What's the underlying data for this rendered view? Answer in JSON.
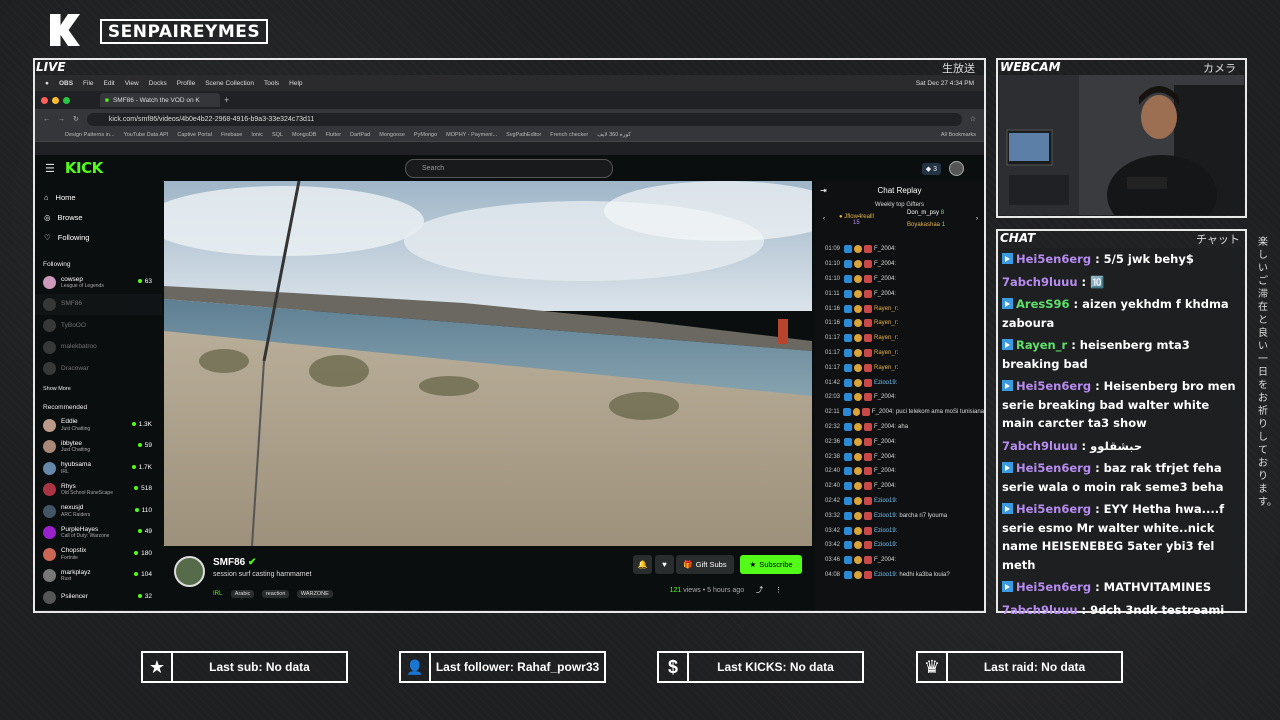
{
  "overlay": {
    "channel_name": "SENPAIREYMES",
    "live_label": "LIVE",
    "live_jp": "生放送",
    "webcam_label": "WEBCAM",
    "webcam_jp": "カメラ",
    "chat_label": "CHAT",
    "chat_jp": "チャット",
    "side_jp": "楽しいご滞在と良い一日をお祈りしております。"
  },
  "menubar": {
    "items": [
      "OBS",
      "File",
      "Edit",
      "View",
      "Docks",
      "Profile",
      "Scene Collection",
      "Tools",
      "Help"
    ],
    "datetime": "Sat Dec 27  4:34 PM"
  },
  "browser": {
    "tab_title": "SMF86 - Watch the VOD on K",
    "url": "kick.com/smf86/videos/4b0e4b22-2968-4916-b9a3-33e324c73d11",
    "bookmarks": [
      "Design Patterns in...",
      "YouTube Data API",
      "Captive Portal",
      "Firebase",
      "Ionic",
      "SQL",
      "MongoDB",
      "Flutter",
      "DartPad",
      "Mongoose",
      "PyMongo",
      "MOPHY - Paymeni...",
      "SvgPathEditor",
      "French checker",
      "كورة 360 لايف",
      "All Bookmarks"
    ]
  },
  "kick": {
    "logo": "KICK",
    "search_placeholder": "Search",
    "badge_count": "3",
    "nav": [
      {
        "label": "Home",
        "icon": "home-icon"
      },
      {
        "label": "Browse",
        "icon": "compass-icon"
      },
      {
        "label": "Following",
        "icon": "heart-icon"
      }
    ],
    "following_heading": "Following",
    "following": [
      {
        "name": "cowsep",
        "sub": "League of Legends",
        "viewers": "63",
        "live": true
      },
      {
        "name": "SMF86",
        "sub": "",
        "viewers": "",
        "live": false
      },
      {
        "name": "TyBoOO",
        "sub": "",
        "viewers": "",
        "live": false
      },
      {
        "name": "malekbatroo",
        "sub": "",
        "viewers": "",
        "live": false
      },
      {
        "name": "Dracowar",
        "sub": "",
        "viewers": "",
        "live": false
      }
    ],
    "show_more": "Show More",
    "recommended_heading": "Recommended",
    "recommended": [
      {
        "name": "Eddie",
        "sub": "Just Chatting",
        "viewers": "1.3K"
      },
      {
        "name": "ibbytee",
        "sub": "Just Chatting",
        "viewers": "59"
      },
      {
        "name": "hyubsama",
        "sub": "IRL",
        "viewers": "1.7K"
      },
      {
        "name": "Rhys",
        "sub": "Old School RuneScape",
        "viewers": "518"
      },
      {
        "name": "nexusjd",
        "sub": "ARC Raiders",
        "viewers": "110"
      },
      {
        "name": "PurpleHayes",
        "sub": "Call of Duty: Warzone",
        "viewers": "49"
      },
      {
        "name": "Chopstix",
        "sub": "Fortnite",
        "viewers": "180"
      },
      {
        "name": "markplayz",
        "sub": "Rust",
        "viewers": "104"
      },
      {
        "name": "Psilencer",
        "sub": "",
        "viewers": "32"
      }
    ],
    "streamer": {
      "name": "SMF86",
      "title": "session surf casting hammamet",
      "tags": [
        "IRL",
        "Arabic",
        "reaction",
        "WARZONE"
      ],
      "views": "121",
      "views_label": "views",
      "age": "5 hours ago",
      "gift_label": "Gift Subs",
      "subscribe_label": "Subscribe"
    },
    "replay": {
      "title": "Chat Replay",
      "gifters_heading": "Weekly top Gifters",
      "gifters": [
        {
          "name": "Jflow4reall!",
          "count": "15"
        },
        {
          "name": "Don_m_psy",
          "count": "8"
        },
        {
          "name": "Boyakashaa",
          "count": "1"
        }
      ],
      "rows": [
        {
          "time": "01:09",
          "user": "F_2004:",
          "text": ""
        },
        {
          "time": "01:10",
          "user": "F_2004:",
          "text": ""
        },
        {
          "time": "01:10",
          "user": "F_2004:",
          "text": ""
        },
        {
          "time": "01:11",
          "user": "F_2004:",
          "text": ""
        },
        {
          "time": "01:16",
          "user": "Rayen_r:",
          "text": ""
        },
        {
          "time": "01:16",
          "user": "Rayen_r:",
          "text": ""
        },
        {
          "time": "01:17",
          "user": "Rayen_r:",
          "text": ""
        },
        {
          "time": "01:17",
          "user": "Rayen_r:",
          "text": ""
        },
        {
          "time": "01:17",
          "user": "Rayen_r:",
          "text": ""
        },
        {
          "time": "01:42",
          "user": "Ezioo19:",
          "text": ""
        },
        {
          "time": "02:03",
          "user": "F_2004:",
          "text": ""
        },
        {
          "time": "02:11",
          "user": "F_2004:",
          "text": "puci telekom ama moSi tunisiana"
        },
        {
          "time": "02:32",
          "user": "F_2004:",
          "text": "aha"
        },
        {
          "time": "02:36",
          "user": "F_2004:",
          "text": ""
        },
        {
          "time": "02:38",
          "user": "F_2004:",
          "text": ""
        },
        {
          "time": "02:40",
          "user": "F_2004:",
          "text": ""
        },
        {
          "time": "02:40",
          "user": "F_2004:",
          "text": ""
        },
        {
          "time": "02:42",
          "user": "Ezioo19:",
          "text": ""
        },
        {
          "time": "03:32",
          "user": "Ezioo19:",
          "text": "barcha ri7 lyouma"
        },
        {
          "time": "03:42",
          "user": "Ezioo19:",
          "text": ""
        },
        {
          "time": "03:42",
          "user": "Ezioo19:",
          "text": ""
        },
        {
          "time": "03:46",
          "user": "F_2004:",
          "text": ""
        },
        {
          "time": "04:08",
          "user": "Ezioo19:",
          "text": "hedhi ka3ba louia?"
        }
      ]
    }
  },
  "chat": [
    {
      "user": "Hei5en6erg",
      "text": ": 5/5 jwk behy$",
      "icon": true,
      "ucls": "u1"
    },
    {
      "user": "7abch9luuu",
      "text": ": 🔟",
      "icon": false,
      "ucls": "u2"
    },
    {
      "user": "AresS96",
      "text": ": aizen yekhdm f khdma zaboura",
      "icon": true,
      "ucls": "u3"
    },
    {
      "user": "Rayen_r",
      "text": ": heisenberg mta3 breaking bad",
      "icon": true,
      "ucls": "u3"
    },
    {
      "user": "Hei5en6erg",
      "text": ": Heisenberg bro men serie breaking bad walter white main carcter ta3 show",
      "icon": true,
      "ucls": "u1"
    },
    {
      "user": "7abch9luuu",
      "text": ": حبشقلوو",
      "icon": false,
      "ucls": "u2"
    },
    {
      "user": "Hei5en6erg",
      "text": ": baz rak tfrjet feha serie wala o moin rak seme3 beha",
      "icon": true,
      "ucls": "u1"
    },
    {
      "user": "Hei5en6erg",
      "text": ": EYY Hetha hwa....f serie esmo Mr walter white..nick name HEISENEBEG 5ater ybi3 fel meth",
      "icon": true,
      "ucls": "u1"
    },
    {
      "user": "Hei5en6erg",
      "text": ": MATHVITAMINES",
      "icon": true,
      "ucls": "u1"
    },
    {
      "user": "7abch9luuu",
      "text": ": 9dch 3ndk testreami",
      "icon": false,
      "ucls": "u2"
    }
  ],
  "alerts": [
    {
      "label": "Last sub: No data",
      "icon": "star-icon",
      "glyph": "★"
    },
    {
      "label": "Last follower: Rahaf_powr33",
      "icon": "user-plus-icon",
      "glyph": "👤"
    },
    {
      "label": "Last KICKS: No data",
      "icon": "dollar-icon",
      "glyph": "$"
    },
    {
      "label": "Last raid: No data",
      "icon": "crown-icon",
      "glyph": "♛"
    }
  ]
}
